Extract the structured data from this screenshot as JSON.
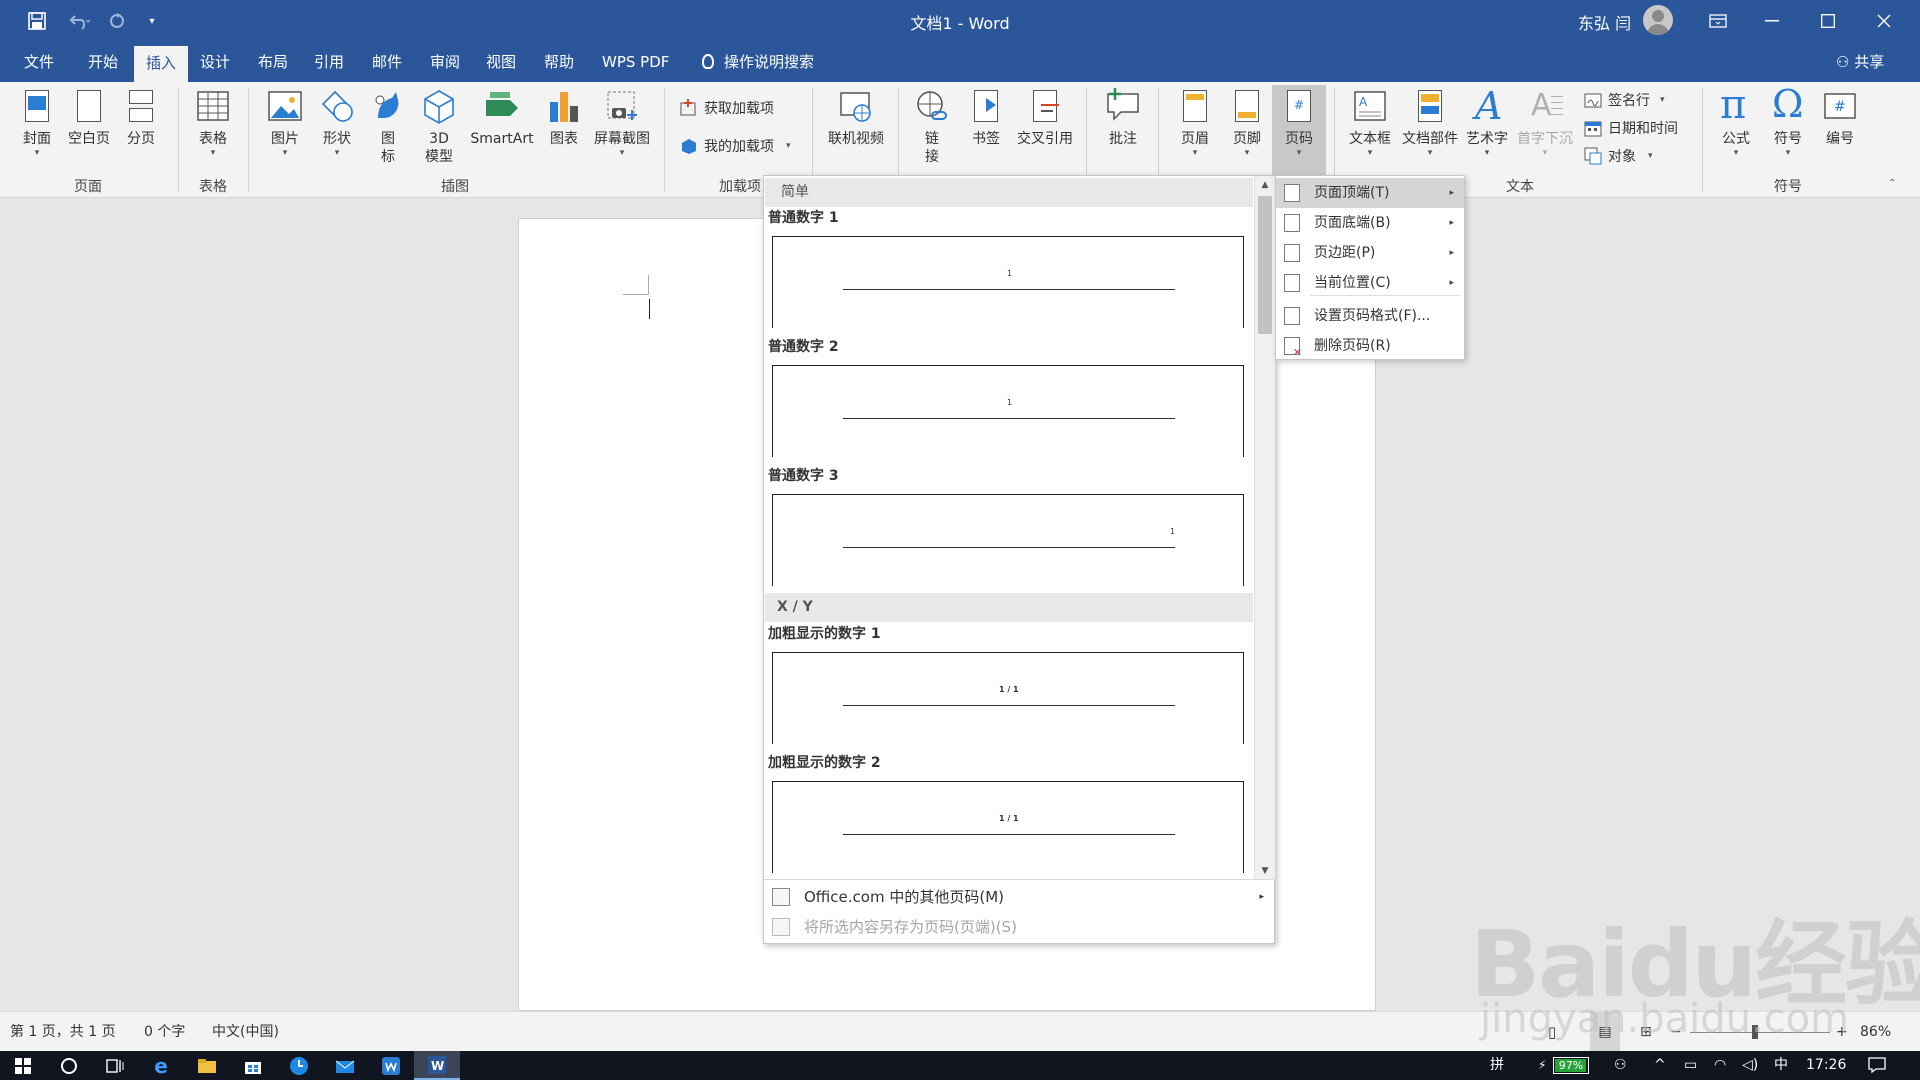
{
  "window": {
    "title": "文档1  -  Word",
    "user": "东弘 闫"
  },
  "tabs": [
    "文件",
    "开始",
    "插入",
    "设计",
    "布局",
    "引用",
    "邮件",
    "审阅",
    "视图",
    "帮助",
    "WPS PDF"
  ],
  "active_tab": "插入",
  "tell_me": "操作说明搜索",
  "share": "共享",
  "ribbon": {
    "pages": {
      "cover": "封面",
      "blank": "空白页",
      "break": "分页",
      "group": "页面"
    },
    "tables": {
      "table": "表格",
      "group": "表格"
    },
    "illustrations": {
      "pictures": "图片",
      "shapes": "形状",
      "icons_l1": "图",
      "icons_l2": "标",
      "model_l1": "3D",
      "model_l2": "模型",
      "smartart": "SmartArt",
      "chart": "图表",
      "screenshot": "屏幕截图",
      "group": "插图"
    },
    "addins": {
      "get": "获取加载项",
      "mine": "我的加载项",
      "group": "加载项"
    },
    "media": {
      "video": "联机视频"
    },
    "links": {
      "link_l1": "链",
      "link_l2": "接",
      "bookmark": "书签",
      "crossref": "交叉引用"
    },
    "comments": {
      "comment": "批注"
    },
    "header_footer": {
      "header": "页眉",
      "footer": "页脚",
      "page_number": "页码"
    },
    "text": {
      "textbox": "文本框",
      "quickparts": "文档部件",
      "wordart": "艺术字",
      "dropcap": "首字下沉",
      "signature": "签名行",
      "datetime": "日期和时间",
      "object": "对象",
      "group": "文本"
    },
    "symbols": {
      "equation": "公式",
      "symbol": "符号",
      "number": "编号",
      "group": "符号"
    }
  },
  "gallery": {
    "section1": "简单",
    "item1": "普通数字 1",
    "item2": "普通数字 2",
    "item3": "普通数字 3",
    "section2": "X / Y",
    "item4": "加粗显示的数字 1",
    "item5": "加粗显示的数字 2",
    "preview_num": "1",
    "preview_xy": "1 / 1",
    "footer_more": "Office.com 中的其他页码(M)",
    "footer_save": "将所选内容另存为页码(页端)(S)"
  },
  "submenu": {
    "top": "页面顶端(T)",
    "bottom": "页面底端(B)",
    "margin": "页边距(P)",
    "current": "当前位置(C)",
    "format": "设置页码格式(F)...",
    "remove": "删除页码(R)"
  },
  "status": {
    "page": "第 1 页，共 1 页",
    "words": "0 个字",
    "lang": "中文(中国)",
    "zoom": "86%",
    "zoom_value": 86
  },
  "taskbar": {
    "ime": "拼",
    "battery": "97%",
    "battery_level": 0.97,
    "lang": "中",
    "time": "17:26"
  },
  "watermark": {
    "brand": "Baidu经验",
    "url": "jingyan.baidu.com"
  },
  "colors": {
    "word_blue": "#2b579a",
    "ribbon_bg": "#f3f3f3",
    "taskbar": "#10151f"
  }
}
